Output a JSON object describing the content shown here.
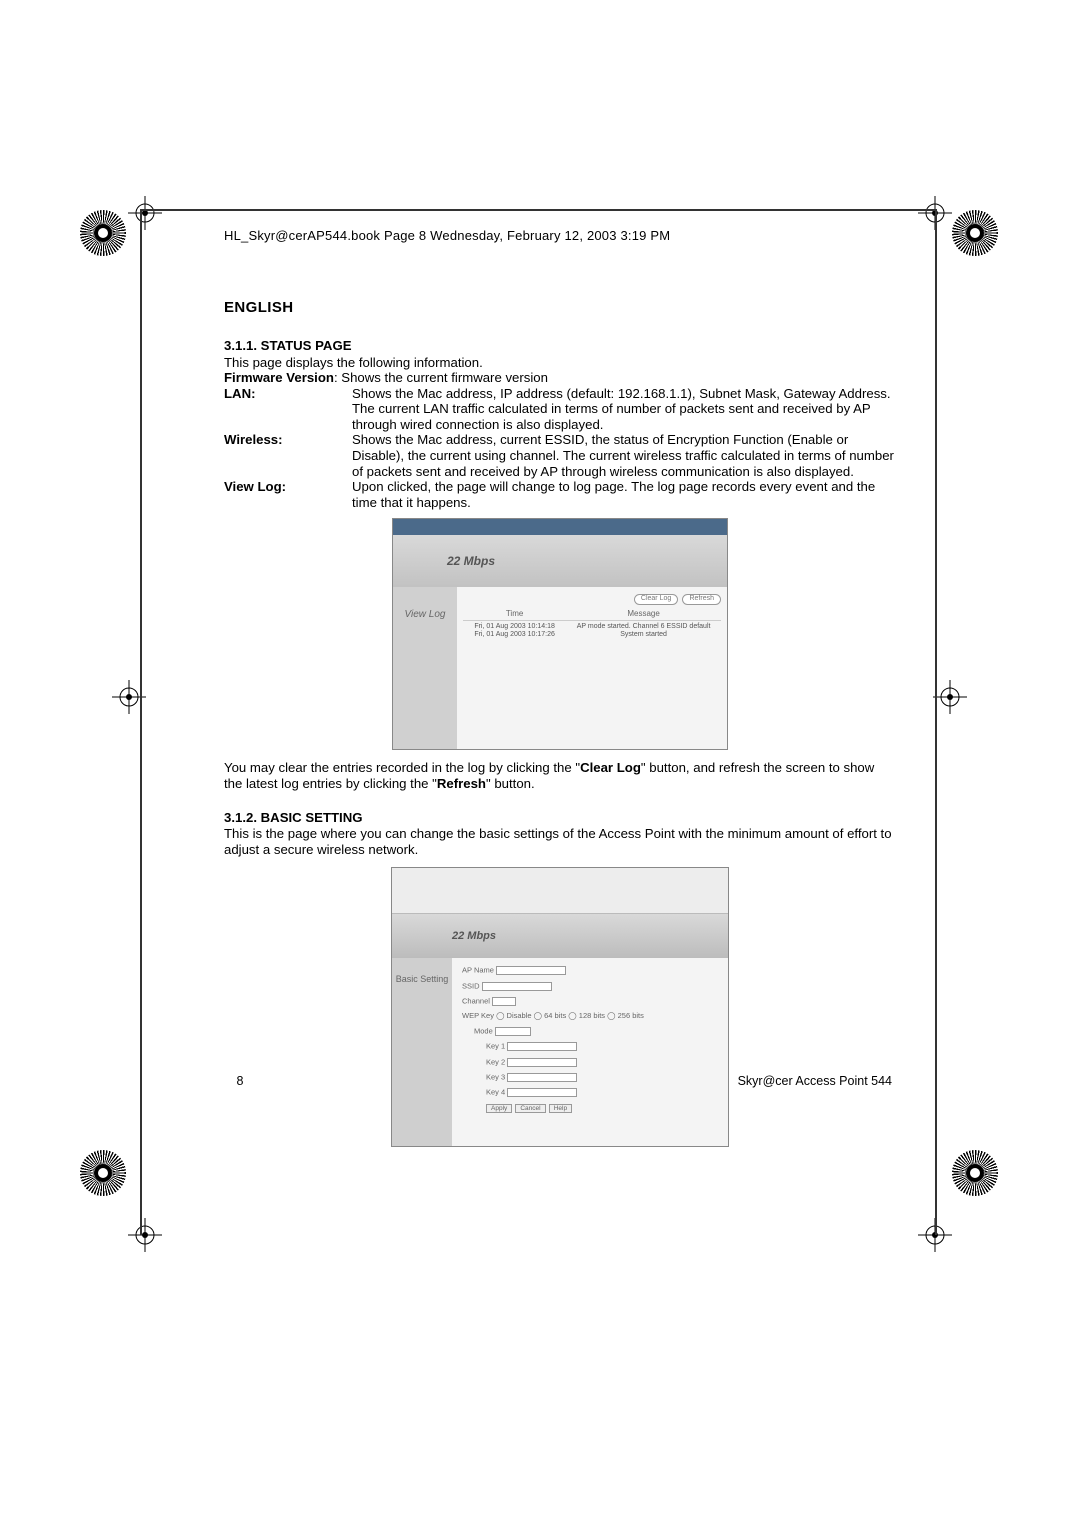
{
  "header_src": "HL_Skyr@cerAP544.book  Page 8  Wednesday, February 12, 2003  3:19 PM",
  "language": "ENGLISH",
  "section1": {
    "number_title": "3.1.1. STATUS PAGE",
    "intro": "This page displays the following information.",
    "firmware_label": "Firmware Version",
    "firmware_text": ": Shows the current firmware version",
    "lan_label": "LAN",
    "lan_text": "Shows the Mac address, IP address (default: 192.168.1.1), Subnet Mask, Gateway Address.  The current LAN traffic calculated in terms of number of packets sent and received by AP through wired connection is also displayed.",
    "wireless_label": "Wireless",
    "wireless_text": "Shows the Mac address, current ESSID, the status of Encryption Function (Enable or Disable), the current using channel. The current wireless traffic calculated in terms of number of packets sent and received by AP through wireless communication is also displayed.",
    "viewlog_label": "View Log",
    "viewlog_text": "Upon clicked, the page will change to log page. The log page records every event and the time that it happens.",
    "after1a": "You may clear the entries recorded in the log by clicking the \"",
    "clearlog": "Clear Log",
    "after1b": "\" button, and refresh the screen to show the latest log entries by clicking the \"",
    "refresh": "Refresh",
    "after1c": "\" button."
  },
  "screenshot1": {
    "banner": "22 Mbps",
    "side": "View Log",
    "btn_clear": "Clear Log",
    "btn_refresh": "Refresh",
    "col_time": "Time",
    "col_message": "Message",
    "row1_time": "Fri, 01 Aug 2003 10:14:18",
    "row1_msg": "AP mode started. Channel 6 ESSID default",
    "row2_time": "Fri, 01 Aug 2003 10:17:26",
    "row2_msg": "System started"
  },
  "section2": {
    "number_title": "3.1.2. BASIC SETTING",
    "text": "This is the page where you can change the basic settings of the Access Point with the minimum amount of effort to adjust a secure wireless network."
  },
  "screenshot2": {
    "banner": "22 Mbps",
    "side": "Basic Setting",
    "apname_label": "AP Name",
    "ssid_label": "SSID",
    "channel_label": "Channel",
    "wep_label": "WEP Key",
    "wep_opts": "◯ Disable  ◯ 64 bits  ◯ 128 bits  ◯ 256 bits",
    "mode_label": "Mode",
    "k1": "Key 1",
    "k2": "Key 2",
    "k3": "Key 3",
    "k4": "Key 4",
    "b_apply": "Apply",
    "b_cancel": "Cancel",
    "b_help": "Help"
  },
  "footer": {
    "page_number": "8",
    "doc_title": "Skyr@cer Access Point 544"
  }
}
